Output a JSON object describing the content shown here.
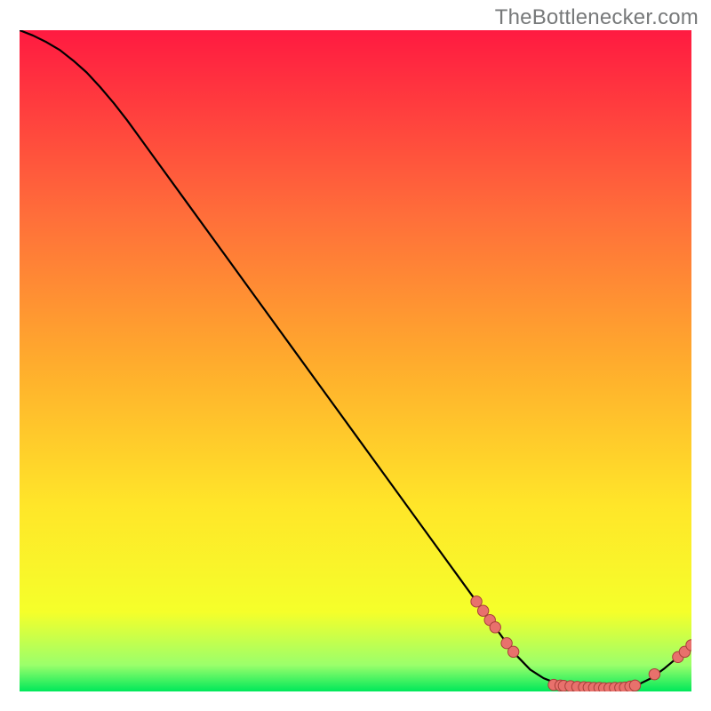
{
  "watermark": "TheBottlenecker.com",
  "colors": {
    "gradient_top": "#ff1a41",
    "gradient_upper_mid": "#ff6e3a",
    "gradient_mid": "#ffab2d",
    "gradient_lower_mid": "#ffe629",
    "gradient_low": "#f5ff2a",
    "gradient_very_low": "#9bff6b",
    "gradient_bottom": "#00e85a",
    "curve": "#000000",
    "dot_fill": "#e8716c",
    "dot_stroke": "#a83f3a"
  },
  "chart_data": {
    "type": "line",
    "title": "",
    "xlabel": "",
    "ylabel": "",
    "xlim": [
      0,
      100
    ],
    "ylim": [
      0,
      100
    ],
    "series": [
      {
        "name": "bottleneck-curve",
        "x": [
          0,
          2,
          4,
          6,
          8,
          10,
          12,
          14,
          16,
          18,
          20,
          25,
          30,
          35,
          40,
          45,
          50,
          55,
          60,
          65,
          70,
          72,
          74,
          76,
          78,
          80,
          82,
          84,
          86,
          88,
          90,
          92,
          94,
          96,
          98,
          100
        ],
        "y": [
          100,
          99.2,
          98.2,
          97.0,
          95.4,
          93.6,
          91.4,
          89.0,
          86.4,
          83.6,
          80.8,
          73.8,
          66.8,
          59.8,
          52.8,
          45.8,
          38.8,
          31.8,
          24.8,
          17.8,
          10.8,
          8.0,
          5.4,
          3.3,
          2.0,
          1.2,
          0.8,
          0.6,
          0.5,
          0.5,
          0.6,
          1.0,
          2.0,
          3.5,
          5.2,
          7.0
        ]
      }
    ],
    "markers": [
      {
        "x": 68.0,
        "y": 13.6
      },
      {
        "x": 69.0,
        "y": 12.2
      },
      {
        "x": 70.0,
        "y": 10.8
      },
      {
        "x": 70.8,
        "y": 9.7
      },
      {
        "x": 72.5,
        "y": 7.3
      },
      {
        "x": 73.5,
        "y": 6.0
      },
      {
        "x": 79.5,
        "y": 1.0
      },
      {
        "x": 80.5,
        "y": 0.9
      },
      {
        "x": 81.0,
        "y": 0.85
      },
      {
        "x": 82.0,
        "y": 0.8
      },
      {
        "x": 83.0,
        "y": 0.7
      },
      {
        "x": 84.0,
        "y": 0.65
      },
      {
        "x": 84.7,
        "y": 0.6
      },
      {
        "x": 85.5,
        "y": 0.55
      },
      {
        "x": 86.3,
        "y": 0.55
      },
      {
        "x": 87.0,
        "y": 0.5
      },
      {
        "x": 87.8,
        "y": 0.5
      },
      {
        "x": 88.6,
        "y": 0.55
      },
      {
        "x": 89.4,
        "y": 0.55
      },
      {
        "x": 90.1,
        "y": 0.6
      },
      {
        "x": 90.9,
        "y": 0.75
      },
      {
        "x": 91.6,
        "y": 0.9
      },
      {
        "x": 94.5,
        "y": 2.6
      },
      {
        "x": 98.0,
        "y": 5.2
      },
      {
        "x": 99.0,
        "y": 6.0
      },
      {
        "x": 100.0,
        "y": 7.0
      }
    ]
  }
}
